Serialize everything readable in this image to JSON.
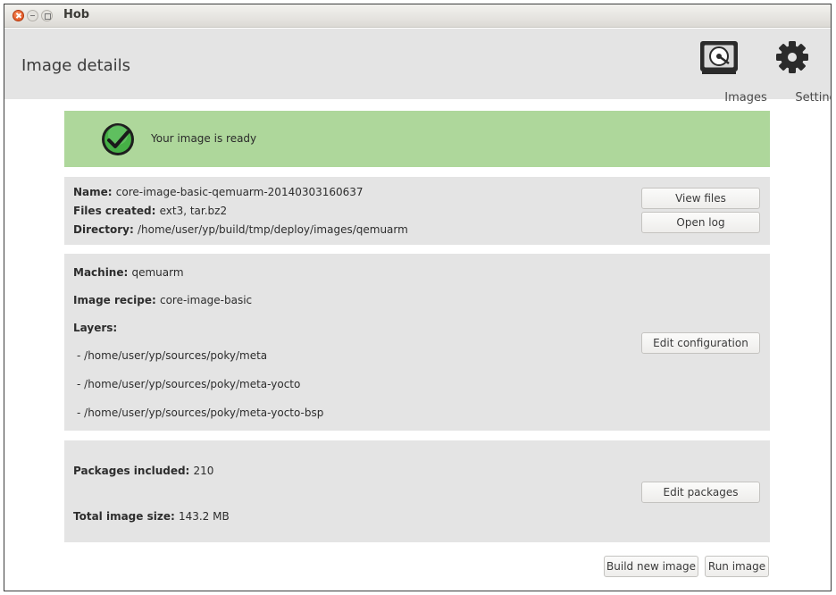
{
  "window": {
    "title": "Hob"
  },
  "header": {
    "page_title": "Image details",
    "images_label": "Images",
    "settings_label": "Settings"
  },
  "banner": {
    "message": "Your image is ready"
  },
  "image_info": {
    "name_label": "Name:",
    "name_value": "core-image-basic-qemuarm-20140303160637",
    "files_label": "Files created:",
    "files_value": "ext3, tar.bz2",
    "directory_label": "Directory:",
    "directory_value": "/home/user/yp/build/tmp/deploy/images/qemuarm",
    "view_files_label": "View files",
    "open_log_label": "Open log"
  },
  "configuration": {
    "machine_label": "Machine:",
    "machine_value": "qemuarm",
    "recipe_label": "Image recipe:",
    "recipe_value": "core-image-basic",
    "layers_label": "Layers:",
    "layers": [
      "- /home/user/yp/sources/poky/meta",
      "- /home/user/yp/sources/poky/meta-yocto",
      "- /home/user/yp/sources/poky/meta-yocto-bsp"
    ],
    "edit_configuration_label": "Edit configuration"
  },
  "packages": {
    "included_label": "Packages included:",
    "included_value": "210",
    "size_label": "Total image size:",
    "size_value": "143.2 MB",
    "edit_packages_label": "Edit packages"
  },
  "footer": {
    "build_new_image_label": "Build new image",
    "run_image_label": "Run image"
  },
  "colors": {
    "banner": "#aed79b",
    "panel": "#e4e4e4",
    "close_button": "#df4a16",
    "check_green": "#3aa83a"
  }
}
